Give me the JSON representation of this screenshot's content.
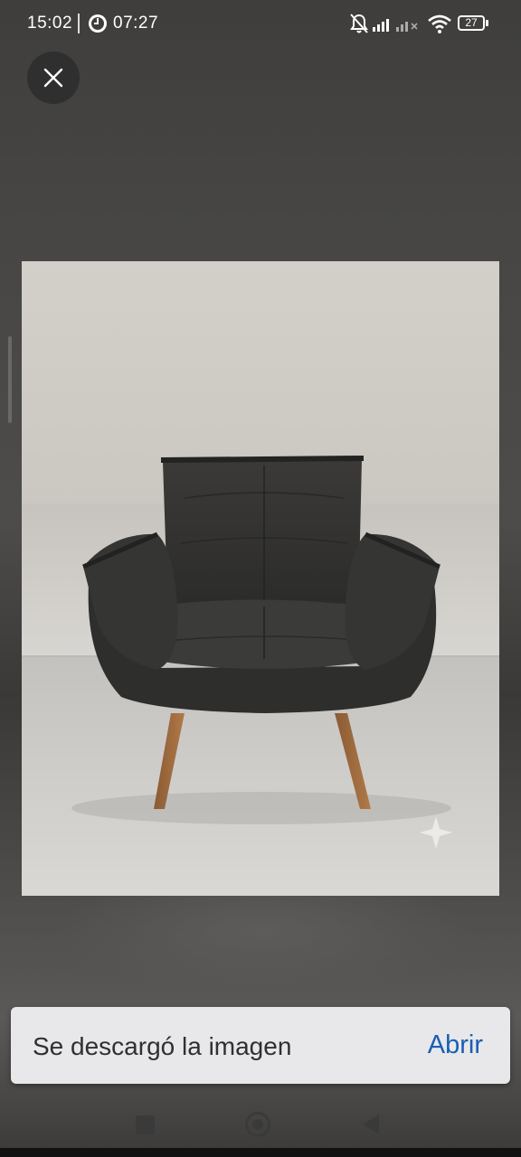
{
  "status_bar": {
    "time": "15:02",
    "timer": "07:27",
    "battery": "27",
    "icons": [
      "clock-icon",
      "bell-off-icon",
      "signal-icon",
      "wifi-icon",
      "battery-icon"
    ]
  },
  "viewer": {
    "close_icon": "close-icon",
    "image_subject": "armchair-image"
  },
  "snackbar": {
    "message": "Se descargó la imagen",
    "action": "Abrir"
  },
  "nav_bar": {
    "icons": [
      "recents-icon",
      "home-icon",
      "back-icon"
    ]
  },
  "colors": {
    "action": "#1a5fb4",
    "snackbar_bg": "#e8e8ea",
    "backdrop": "#4a4947"
  }
}
